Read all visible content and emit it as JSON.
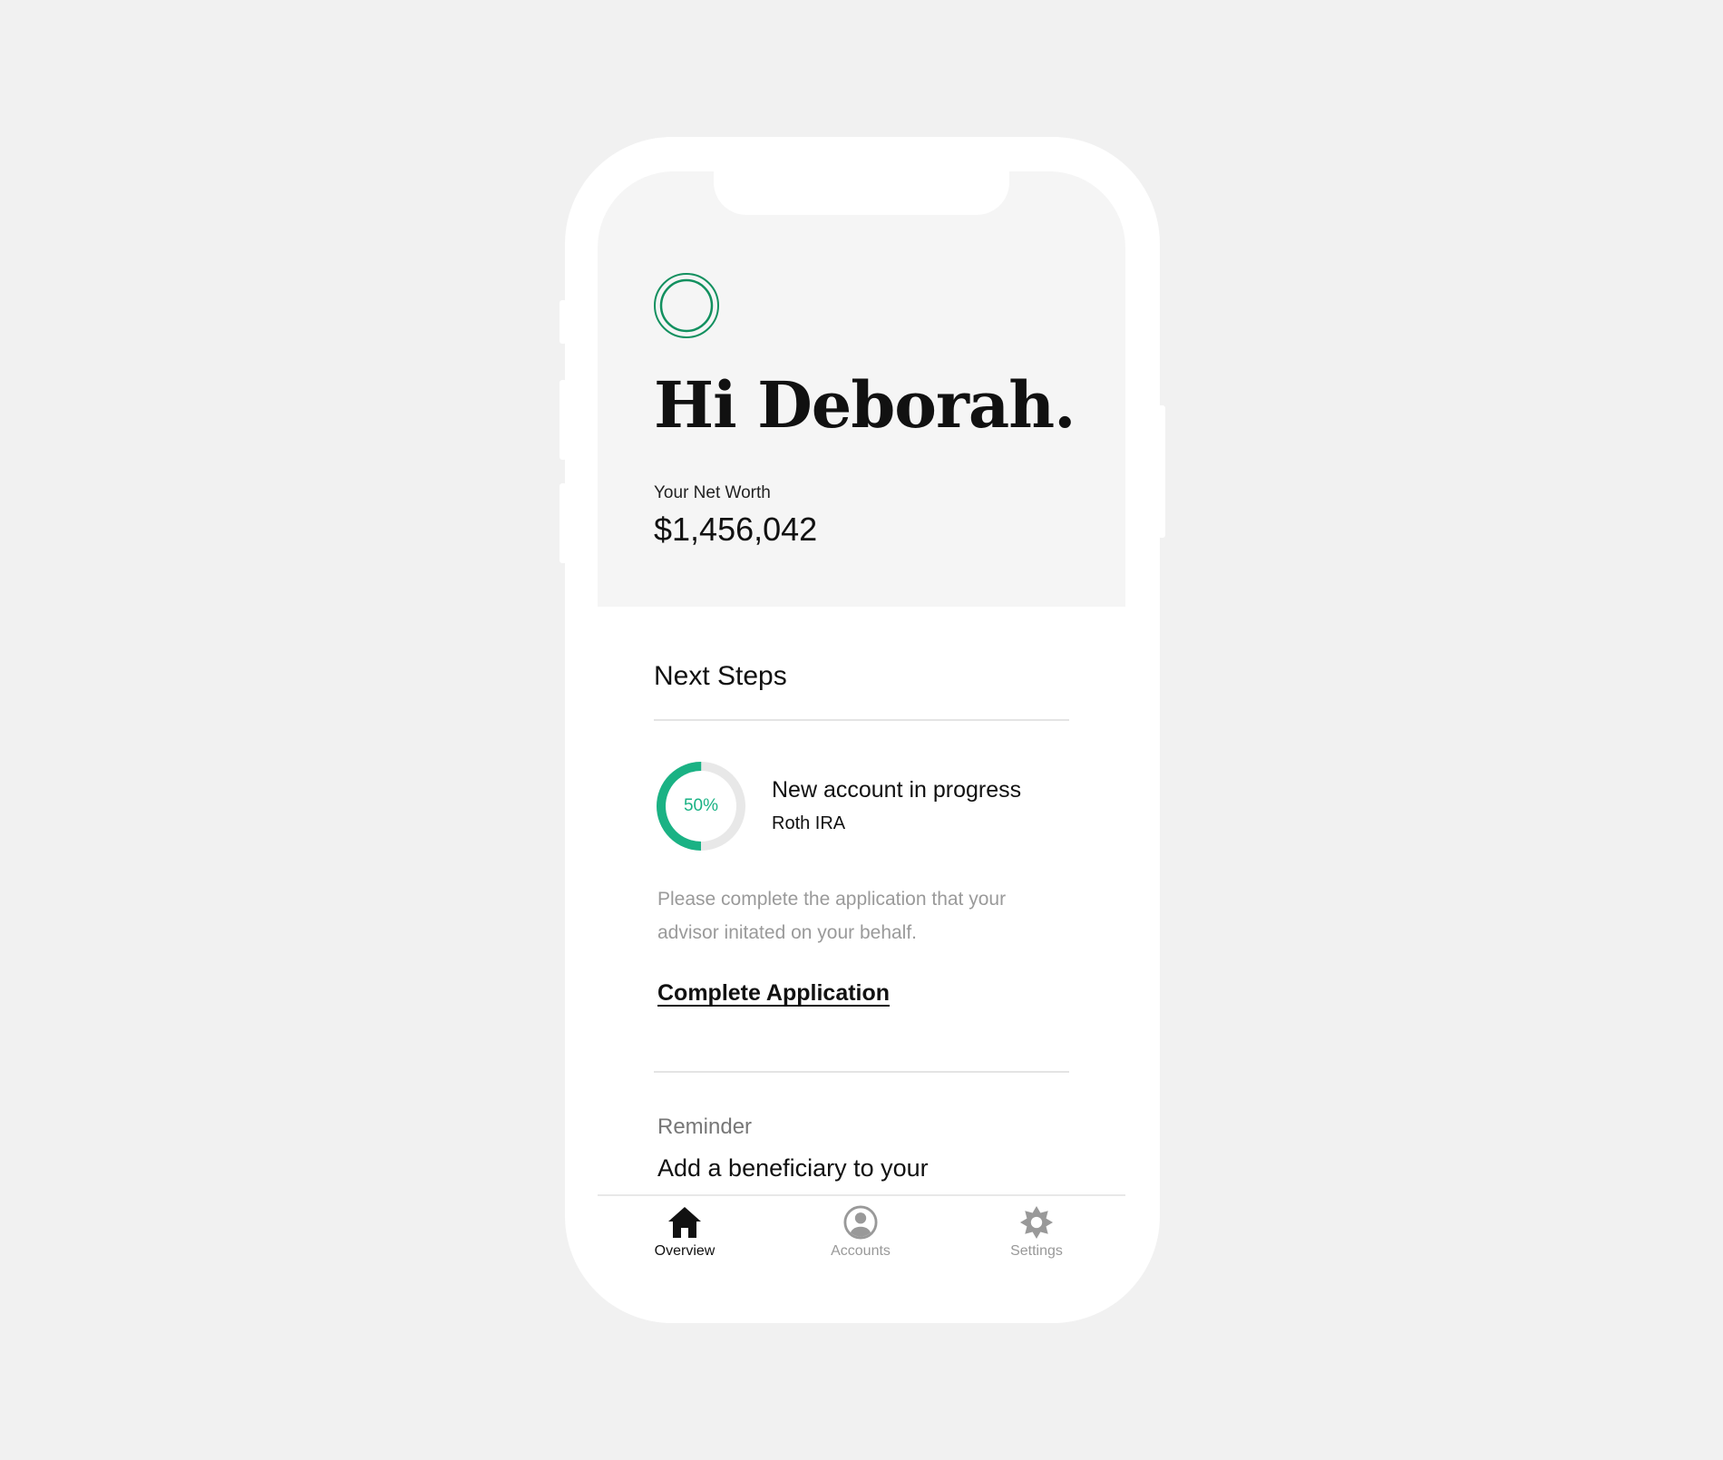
{
  "colors": {
    "accent": "#1ab284",
    "logo_green": "#12905f",
    "text_primary": "#111111",
    "text_muted": "#9a9a9a",
    "hero_bg": "#f5f5f5",
    "page_bg": "#f1f1f1"
  },
  "header": {
    "logo_icon": "ring-logo-icon",
    "greeting": "Hi Deborah.",
    "net_worth_label": "Your Net Worth",
    "net_worth_value": "$1,456,042"
  },
  "next_steps": {
    "title": "Next Steps",
    "task": {
      "progress": 0.5,
      "progress_label": "50%",
      "title": "New account in progress",
      "subtitle": "Roth IRA",
      "description": "Please complete the application that your advisor initated on your behalf.",
      "cta_label": "Complete Application"
    },
    "reminder": {
      "label": "Reminder",
      "text": "Add a beneficiary to your"
    }
  },
  "tabbar": {
    "tabs": [
      {
        "label": "Overview",
        "icon": "home-icon",
        "active": true
      },
      {
        "label": "Accounts",
        "icon": "user-circle-icon",
        "active": false
      },
      {
        "label": "Settings",
        "icon": "gear-icon",
        "active": false
      }
    ]
  }
}
